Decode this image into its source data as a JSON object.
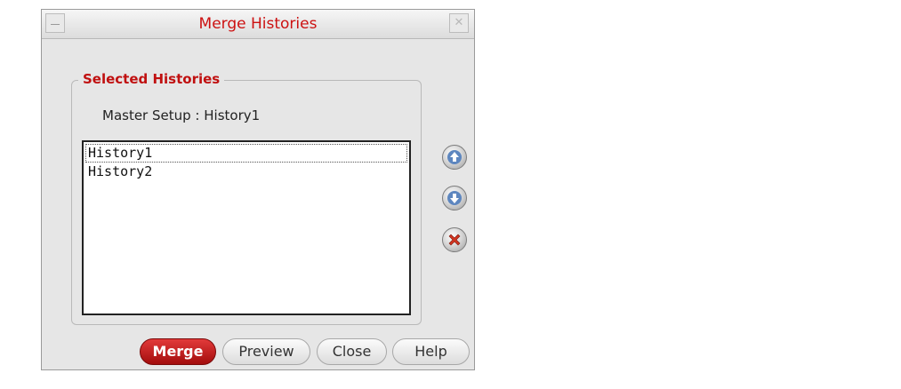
{
  "window": {
    "title": "Merge Histories"
  },
  "group": {
    "label": "Selected Histories"
  },
  "master_setup": {
    "text": "Master Setup : History1"
  },
  "histories": {
    "items": [
      "History1",
      "History2"
    ],
    "selected": "History1"
  },
  "side_buttons": {
    "up": "arrow-up-icon",
    "down": "arrow-down-icon",
    "delete": "delete-x-icon"
  },
  "buttons": {
    "merge": "Merge",
    "preview": "Preview",
    "close": "Close",
    "help": "Help"
  },
  "colors": {
    "title": "#cc1111",
    "accent": "#c01010",
    "merge_bg": "#c21414"
  }
}
